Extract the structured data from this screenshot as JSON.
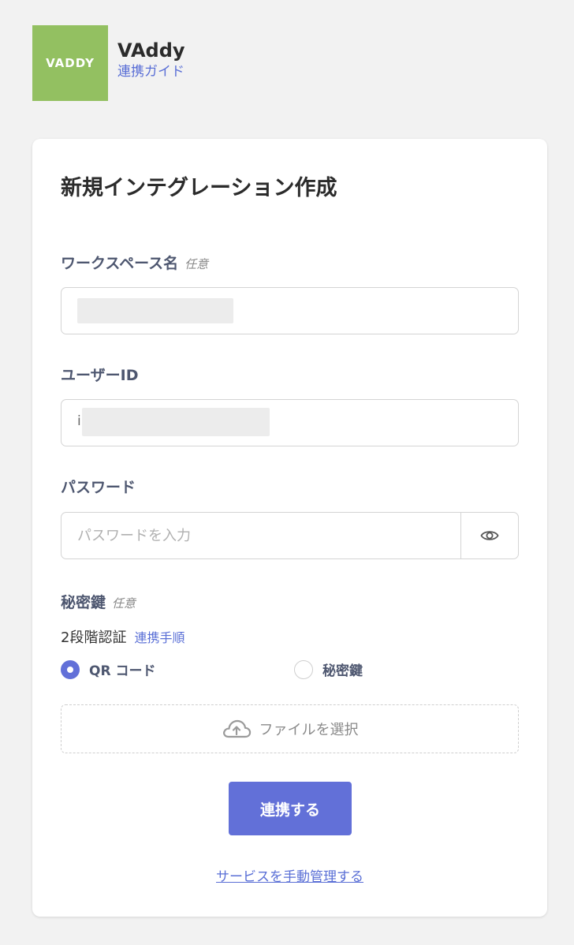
{
  "app": {
    "logo_text": "VADDY",
    "name": "VAddy",
    "guide_link": "連携ガイド",
    "logo_color": "#93c061"
  },
  "form": {
    "title": "新規インテグレーション作成",
    "workspace": {
      "label": "ワークスペース名",
      "optional": "任意",
      "value": ""
    },
    "user_id": {
      "label": "ユーザーID",
      "value_prefix": "i"
    },
    "password": {
      "label": "パスワード",
      "placeholder": "パスワードを入力",
      "toggle_icon": "eye-icon"
    },
    "secret_key": {
      "label": "秘密鍵",
      "optional": "任意",
      "twofa_label": "2段階認証",
      "twofa_link": "連携手順",
      "options": [
        {
          "label": "QR コード",
          "checked": true
        },
        {
          "label": "秘密鍵",
          "checked": false
        }
      ]
    },
    "file_select": {
      "label": "ファイルを選択",
      "icon": "cloud-upload-icon"
    },
    "submit_label": "連携する",
    "manual_link": "サービスを手動管理する"
  },
  "colors": {
    "accent": "#6270d8",
    "link": "#5a6fd6",
    "label": "#4e5770",
    "background": "#f2f2f2"
  }
}
